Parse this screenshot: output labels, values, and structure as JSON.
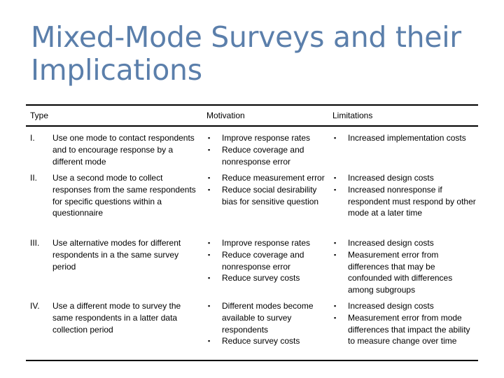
{
  "title": "Mixed-Mode Surveys and their Implications",
  "table": {
    "headers": {
      "type": "Type",
      "motivation": "Motivation",
      "limitations": "Limitations"
    },
    "bullet_glyph": "▪",
    "rows": [
      {
        "number": "I.",
        "description": "Use one mode to contact respondents and to encourage response by a different mode",
        "motivation": [
          "Improve response rates",
          "Reduce coverage and nonresponse error"
        ],
        "limitations": [
          "Increased implementation costs"
        ]
      },
      {
        "number": "II.",
        "description": "Use a second mode to collect responses from the same respondents for specific questions within a questionnaire",
        "motivation": [
          "Reduce measurement error",
          "Reduce social desirability bias for sensitive question"
        ],
        "limitations": [
          "Increased design costs",
          "Increased nonresponse if respondent must respond by other mode at a later time"
        ]
      },
      {
        "number": "III.",
        "description": "Use alternative modes for different respondents in a the same survey period",
        "motivation": [
          "Improve response rates",
          "Reduce coverage and nonresponse error",
          "Reduce survey costs"
        ],
        "limitations": [
          "Increased design costs",
          "Measurement error from differences that may be confounded with differences among subgroups"
        ]
      },
      {
        "number": "IV.",
        "description": "Use a different mode to survey the same respondents in a latter data collection period",
        "motivation": [
          "Different modes become available to survey respondents",
          "Reduce survey costs"
        ],
        "limitations": [
          "Increased design costs",
          "Measurement error from mode differences that impact the ability to measure change over time"
        ]
      }
    ]
  }
}
